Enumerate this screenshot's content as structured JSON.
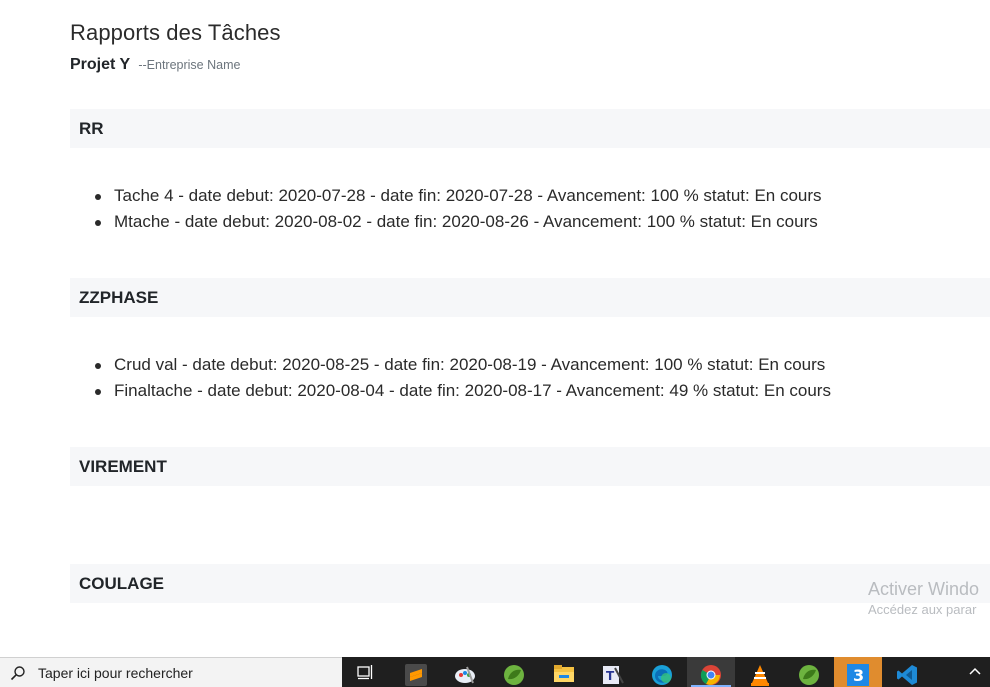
{
  "page": {
    "title": "Rapports des Tâches",
    "project_name": "Projet Y",
    "company_label": "--Entreprise Name"
  },
  "phases": [
    {
      "name": "RR",
      "tasks": [
        "Tache 4 - date debut: 2020-07-28 - date fin: 2020-07-28 - Avancement: 100 % statut: En cours",
        "Mtache - date debut: 2020-08-02 - date fin: 2020-08-26 - Avancement: 100 % statut: En cours"
      ]
    },
    {
      "name": "ZZPHASE",
      "tasks": [
        "Crud val - date debut: 2020-08-25 - date fin: 2020-08-19 - Avancement: 100 % statut: En cours",
        "Finaltache - date debut: 2020-08-04 - date fin: 2020-08-17 - Avancement: 49 % statut: En cours"
      ]
    },
    {
      "name": "VIREMENT",
      "tasks": []
    },
    {
      "name": "COULAGE",
      "tasks": []
    }
  ],
  "watermark": {
    "title": "Activer Windo",
    "subtitle": "Accédez aux parar"
  },
  "taskbar": {
    "search_placeholder": "Taper ici pour rechercher",
    "apps": [
      {
        "icon": "task-view-icon"
      },
      {
        "icon": "sublime-text-icon"
      },
      {
        "icon": "paint-icon"
      },
      {
        "icon": "spring-tool-suite-icon"
      },
      {
        "icon": "file-explorer-icon"
      },
      {
        "icon": "text-editor-icon"
      },
      {
        "icon": "edge-icon"
      },
      {
        "icon": "chrome-icon"
      },
      {
        "icon": "vlc-icon"
      },
      {
        "icon": "spring-tool-suite-icon-2"
      },
      {
        "icon": "badge-3-icon"
      },
      {
        "icon": "vscode-icon"
      }
    ]
  }
}
